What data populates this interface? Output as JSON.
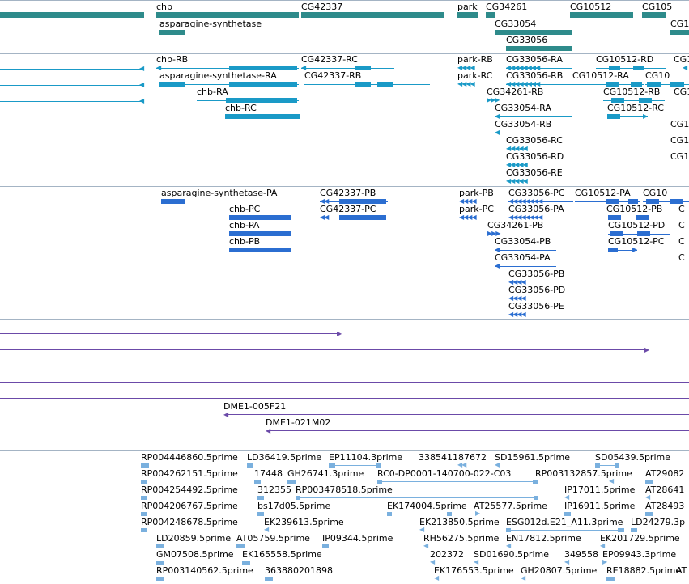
{
  "colors": {
    "gene": "#2e8b8b",
    "transcript": "#1a9ac7",
    "protein": "#2b6ed1",
    "clone": "#6b4aa8",
    "est": "#7ab0de",
    "separator": "#a4b4c4"
  },
  "tracks": {
    "genes": {
      "labels": [
        "chb",
        "CG42337",
        "park",
        "CG34261",
        "CG10512",
        "CG105",
        "asparagine-synthetase",
        "CG33054",
        "CG1",
        "CG33056"
      ]
    },
    "transcripts": {
      "labels": [
        "chb-RB",
        "CG42337-RC",
        "park-RB",
        "CG33056-RA",
        "CG10512-RD",
        "CG1",
        "asparagine-synthetase-RA",
        "CG42337-RB",
        "park-RC",
        "CG33056-RB",
        "CG10512-RA",
        "CG10",
        "chb-RA",
        "CG34261-RB",
        "CG10512-RB",
        "CG1",
        "chb-RC",
        "CG33054-RA",
        "CG10512-RC",
        "CG33054-RB",
        "CG1",
        "CG33056-RC",
        "CG1",
        "CG33056-RD",
        "CG1",
        "CG33056-RE"
      ]
    },
    "proteins": {
      "labels": [
        "asparagine-synthetase-PA",
        "CG42337-PB",
        "park-PB",
        "CG33056-PC",
        "CG10512-PA",
        "CG10",
        "chb-PC",
        "CG42337-PC",
        "park-PC",
        "CG33056-PA",
        "CG10512-PB",
        "C",
        "chb-PA",
        "CG34261-PB",
        "CG10512-PD",
        "C",
        "chb-PB",
        "CG33054-PB",
        "CG10512-PC",
        "C",
        "CG33054-PA",
        "C",
        "CG33056-PB",
        "CG33056-PD",
        "CG33056-PE"
      ]
    },
    "clones": {
      "labels": [
        "DME1-005F21",
        "DME1-021M02"
      ]
    },
    "ests": {
      "labels": [
        "RP004446860.5prime",
        "LD36419.5prime",
        "EP11104.3prime",
        "338541187672",
        "SD15961.5prime",
        "SD05439.5prime",
        "RP004262151.5prime",
        "17448",
        "GH26741.3prime",
        "RC0-DP0001-140700-022-C03",
        "RP003132857.5prime",
        "AT29082",
        "RP004254492.5prime",
        "312355",
        "RP003478518.5prime",
        "IP17011.5prime",
        "AT28641",
        "RP004206767.5prime",
        "bs17d05.5prime",
        "EK174004.5prime",
        "AT25577.5prime",
        "IP16911.5prime",
        "AT28493",
        "RP004248678.5prime",
        "EK239613.5prime",
        "EK213850.5prime",
        "ESG012d.E21_A11.3prime",
        "LD24279.3p",
        "LD20859.5prime",
        "AT05759.5prime",
        "IP09344.5prime",
        "RH56275.5prime",
        "EN17812.5prime",
        "EK201729.5prime",
        "GM07508.5prime",
        "EK165558.5prime",
        "202372",
        "SD01690.5prime",
        "349558",
        "EP09943.3prime",
        "RP003140562.5prime",
        "363880201898",
        "EK176553.5prime",
        "GH20807.5prime",
        "RE18882.5prime",
        "AT"
      ]
    }
  }
}
